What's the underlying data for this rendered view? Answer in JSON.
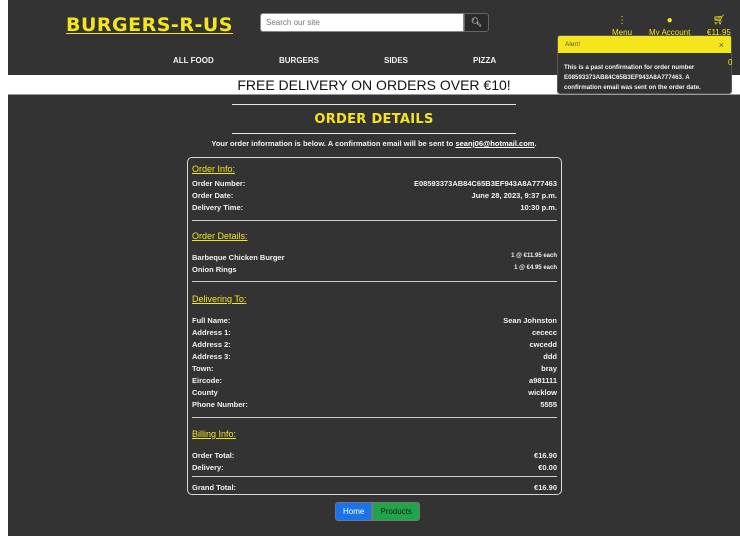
{
  "header": {
    "brand": "BURGERS-R-US",
    "search_placeholder": "Search our site",
    "links": [
      {
        "icon": "menu-icon",
        "label": "Menu"
      },
      {
        "icon": "user-icon",
        "label": "My Account"
      },
      {
        "icon": "cart-icon",
        "label": "€11.95"
      }
    ]
  },
  "nav": [
    "ALL FOOD",
    "BURGERS",
    "SIDES",
    "PIZZA"
  ],
  "banner": "FREE DELIVERY ON ORDERS OVER €10!",
  "page_title": "ORDER DETAILS",
  "intro": {
    "text": "Your order information is below. A confirmation email will be sent to ",
    "email": "seanj06@hotmail.com",
    "suffix": "."
  },
  "order_info": {
    "heading": "Order Info:",
    "rows": [
      {
        "label": "Order Number:",
        "value": "E08593373AB84C65B3EF943A8A777463"
      },
      {
        "label": "Order Date:",
        "value": "June 28, 2023, 9:37 p.m."
      },
      {
        "label": "Delivery Time:",
        "value": "10:30 p.m."
      }
    ]
  },
  "order_details": {
    "heading": "Order Details:",
    "items": [
      {
        "name": "Barbeque Chicken Burger",
        "qty_price": "1 @ €11.95 each"
      },
      {
        "name": "Onion Rings",
        "qty_price": "1 @ €4.95 each"
      }
    ]
  },
  "delivering_to": {
    "heading": "Delivering To:",
    "rows": [
      {
        "label": "Full Name:",
        "value": "Sean Johnston"
      },
      {
        "label": "Address 1:",
        "value": "cececc"
      },
      {
        "label": "Address 2:",
        "value": "cwcedd"
      },
      {
        "label": "Address 3:",
        "value": "ddd"
      },
      {
        "label": "Town:",
        "value": "bray"
      },
      {
        "label": "Eircode:",
        "value": "a981111"
      },
      {
        "label": "County",
        "value": "wicklow"
      },
      {
        "label": "Phone Number:",
        "value": "5555"
      }
    ]
  },
  "billing_info": {
    "heading": "Billing Info:",
    "rows": [
      {
        "label": "Order Total:",
        "value": "€16.90"
      },
      {
        "label": "Delivery:",
        "value": "€0.00"
      }
    ],
    "grand_total": {
      "label": "Grand Total:",
      "value": "€16.90"
    }
  },
  "buttons": {
    "home": "Home",
    "products": "Products"
  },
  "toast": {
    "label": "Alert!",
    "close": "×",
    "message": "This is a past confirmation for order number E08593373AB84C65B3EF943A8A777463. A confirmation email was sent on the order date.",
    "trailing": "0"
  },
  "colors": {
    "accent": "#f5e61c",
    "background": "#333333",
    "home_button": "#1a73e8",
    "products_button": "#1fa64a"
  }
}
